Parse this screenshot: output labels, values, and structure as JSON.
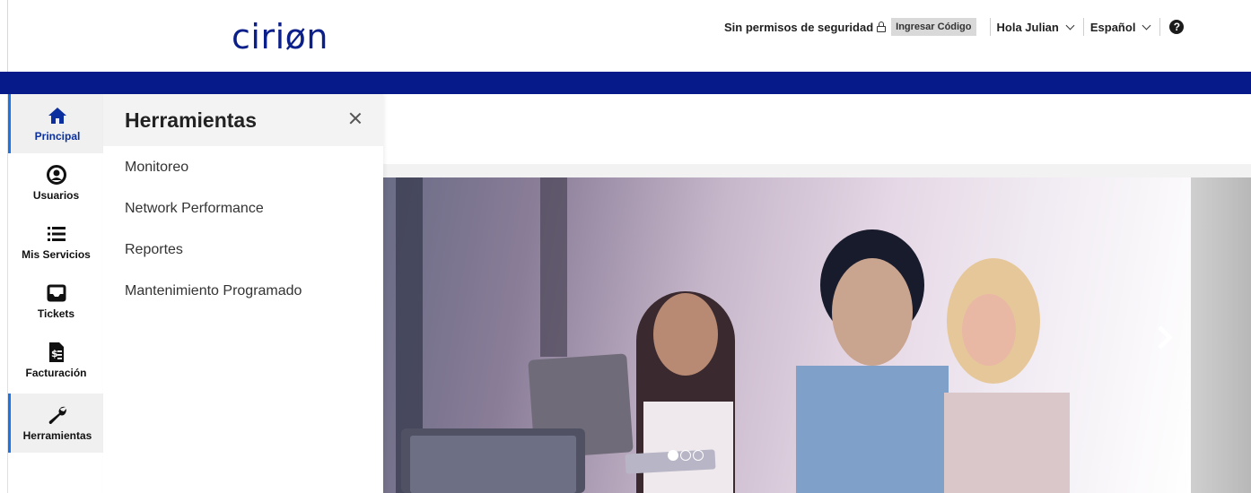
{
  "brand": {
    "logo_text": "ciriøn",
    "accent": "#e8127c",
    "primary": "#0b1f8a",
    "bar_color": "#061a8a"
  },
  "topbar": {
    "security_text": "Sin permisos de seguridad",
    "code_button": "Ingresar Código",
    "user_menu": "Hola Julian",
    "language_menu": "Español",
    "help_icon": "?"
  },
  "sidebar": {
    "items": [
      {
        "label": "Principal",
        "icon": "home-icon"
      },
      {
        "label": "Usuarios",
        "icon": "user-circle-icon"
      },
      {
        "label": "Mis Servicios",
        "icon": "list-icon"
      },
      {
        "label": "Tickets",
        "icon": "inbox-icon"
      },
      {
        "label": "Facturación",
        "icon": "invoice-icon"
      },
      {
        "label": "Herramientas",
        "icon": "wrench-icon"
      }
    ]
  },
  "panel": {
    "title": "Herramientas",
    "items": [
      "Monitoreo",
      "Network Performance",
      "Reportes",
      "Mantenimiento Programado"
    ]
  },
  "carousel": {
    "dots": 3,
    "active_dot": 1
  }
}
